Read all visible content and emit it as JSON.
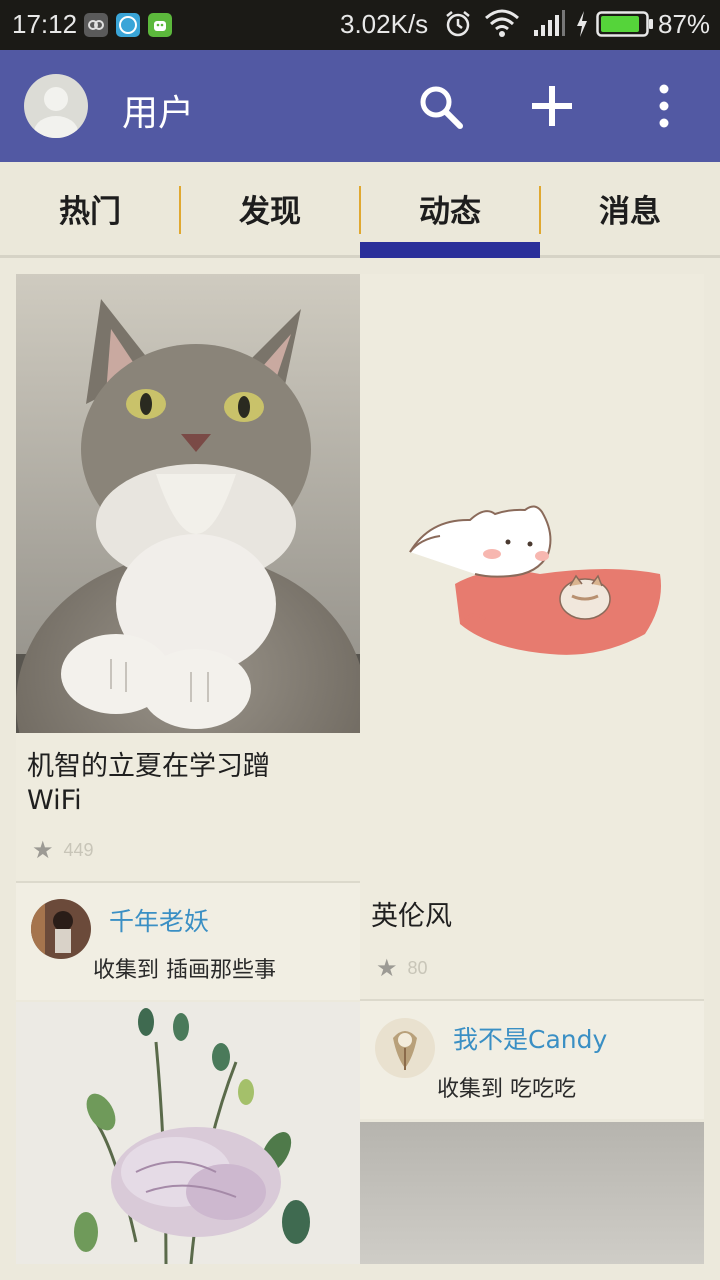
{
  "status_bar": {
    "time": "17:12",
    "net_speed": "3.02K/s",
    "battery": "87%",
    "icons": [
      "notification-app-icon",
      "notification-24h-icon",
      "notification-android-icon",
      "alarm-icon",
      "wifi-icon",
      "signal-icon",
      "charging-icon",
      "battery-icon"
    ]
  },
  "app_bar": {
    "title": "用户",
    "actions": [
      "search-icon",
      "add-icon",
      "more-vert-icon"
    ],
    "color": "#5259a3"
  },
  "tabs": {
    "items": [
      "热门",
      "发现",
      "动态",
      "消息"
    ],
    "selected": "动态",
    "indicator_color": "#2a2f9a",
    "divider_color": "#e0a830"
  },
  "feed": {
    "cards": [
      {
        "image": "cat-photo",
        "title_line1": "机智的立夏在学习蹭",
        "title_line2": "WiFi",
        "stars": "449",
        "user": "千年老妖",
        "collect_prefix": "收集到",
        "board": "插画那些事"
      },
      {
        "image": "cat-illustration",
        "title": "英伦风",
        "stars": "80",
        "user": "我不是Candy",
        "collect_prefix": "收集到",
        "board": "吃吃吃"
      },
      {
        "image": "flower-watercolor"
      },
      {
        "image": "grey-photo"
      }
    ]
  }
}
